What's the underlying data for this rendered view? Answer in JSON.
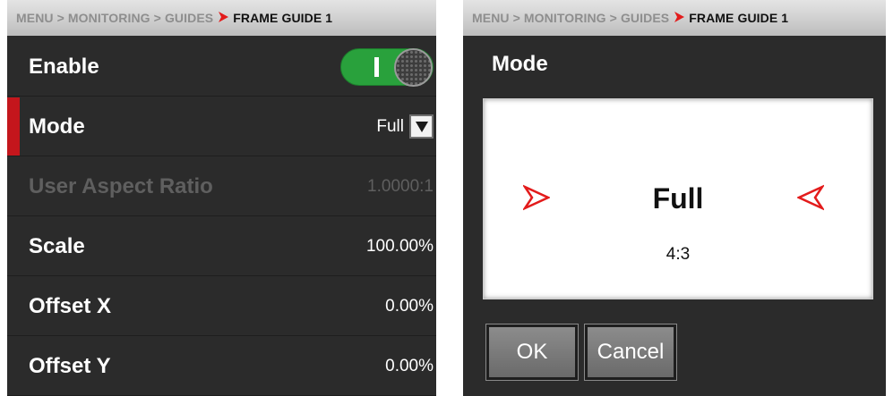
{
  "breadcrumb": {
    "items": [
      "MENU",
      "MONITORING",
      "GUIDES"
    ],
    "current": "FRAME GUIDE 1",
    "separator": ">"
  },
  "settings": {
    "enable": {
      "label": "Enable",
      "state": "on"
    },
    "mode": {
      "label": "Mode",
      "value": "Full"
    },
    "user_aspect_ratio": {
      "label": "User Aspect Ratio",
      "value": "1.0000:1"
    },
    "scale": {
      "label": "Scale",
      "value": "100.00%"
    },
    "offset_x": {
      "label": "Offset X",
      "value": "0.00%"
    },
    "offset_y": {
      "label": "Offset Y",
      "value": "0.00%"
    }
  },
  "dialog": {
    "title": "Mode",
    "picker_value": "Full",
    "picker_subtext": "4:3",
    "ok_label": "OK",
    "cancel_label": "Cancel"
  },
  "colors": {
    "accent_red": "#c4161c",
    "toggle_green": "#29a13c",
    "panel_bg": "#2b2b2b"
  },
  "icons": [
    "chevron-right-red-icon",
    "dropdown-arrow-icon",
    "picker-prev-icon",
    "picker-next-icon"
  ]
}
